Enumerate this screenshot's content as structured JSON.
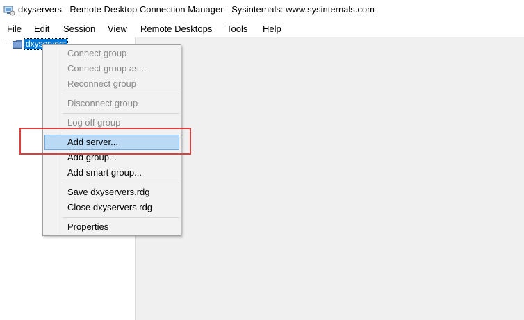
{
  "window": {
    "title": "dxyservers - Remote Desktop Connection Manager - Sysinternals: www.sysinternals.com",
    "app_icon": "rdcman-icon"
  },
  "menubar": {
    "items": [
      "File",
      "Edit",
      "Session",
      "View",
      "Remote Desktops",
      "Tools",
      "Help"
    ]
  },
  "tree": {
    "root_label": "dxyservers",
    "root_icon": "folder-icon"
  },
  "context_menu": {
    "items": [
      {
        "label": "Connect group",
        "enabled": false
      },
      {
        "label": "Connect group as...",
        "enabled": false
      },
      {
        "label": "Reconnect group",
        "enabled": false
      },
      {
        "label": "Disconnect group",
        "enabled": false
      },
      {
        "label": "Log off group",
        "enabled": false
      },
      {
        "label": "Add server...",
        "enabled": true,
        "highlighted": true
      },
      {
        "label": "Add group...",
        "enabled": true
      },
      {
        "label": "Add smart group...",
        "enabled": true
      },
      {
        "label": "Save dxyservers.rdg",
        "enabled": true
      },
      {
        "label": "Close dxyservers.rdg",
        "enabled": true
      },
      {
        "label": "Properties",
        "enabled": true
      }
    ]
  },
  "colors": {
    "selection": "#0078d7",
    "highlight": "#b9d9f4",
    "annotation": "#e03c3c",
    "panel_bg": "#f0f0f0"
  }
}
